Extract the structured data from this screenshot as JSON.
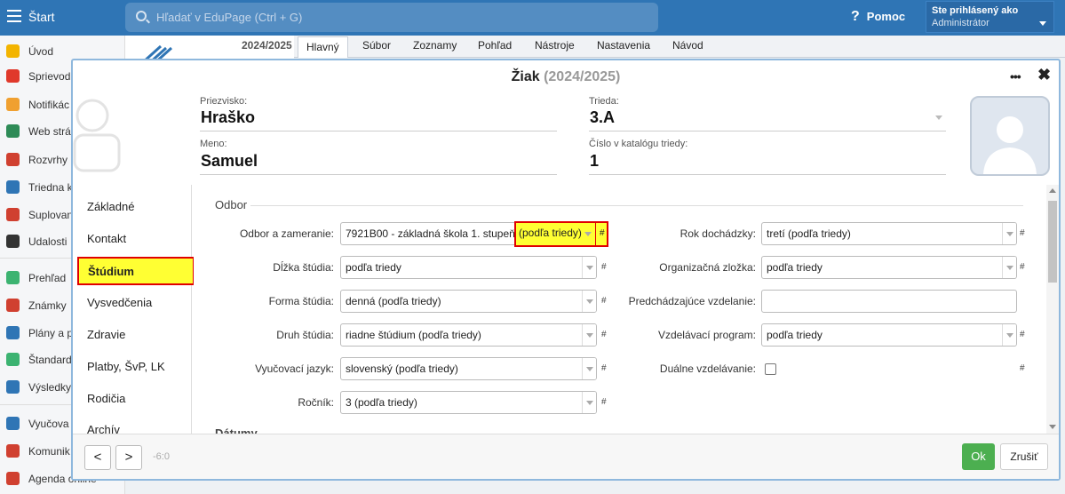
{
  "topbar": {
    "start_label": "Štart",
    "search_placeholder": "Hľadať v EduPage (Ctrl + G)",
    "help_label": "Pomoc",
    "logged_in_label": "Ste prihlásený ako",
    "user_role": "Administrátor"
  },
  "sidebar": {
    "items": [
      {
        "label": "Úvod",
        "icon": "star-icon",
        "color": "#f3b400"
      },
      {
        "label": "Sprievod",
        "icon": "wand-icon",
        "color": "#e0392b"
      },
      {
        "label": "Notifikác",
        "icon": "envelope-icon",
        "color": "#f0a030"
      },
      {
        "label": "Web strá",
        "icon": "home-icon",
        "color": "#2e8b57"
      },
      {
        "label": "Rozvrhy",
        "icon": "grid-icon",
        "color": "#d04030"
      },
      {
        "label": "Triedna k",
        "icon": "book-icon",
        "color": "#2f75b5"
      },
      {
        "label": "Suplovan",
        "icon": "person-icon",
        "color": "#d04030"
      },
      {
        "label": "Udalosti",
        "icon": "calendar-icon",
        "color": "#333333"
      },
      {
        "label": "Prehľad",
        "icon": "check-circle-icon",
        "color": "#3cb371"
      },
      {
        "label": "Známky",
        "icon": "grade-icon",
        "color": "#d04030"
      },
      {
        "label": "Plány a p",
        "icon": "briefcase-icon",
        "color": "#2f75b5"
      },
      {
        "label": "Štandard",
        "icon": "shield-icon",
        "color": "#3cb371"
      },
      {
        "label": "Výsledky",
        "icon": "bar-chart-icon",
        "color": "#2f75b5"
      },
      {
        "label": "Vyučova",
        "icon": "books-icon",
        "color": "#2f75b5"
      },
      {
        "label": "Komunik",
        "icon": "chat-icon",
        "color": "#d04030"
      },
      {
        "label": "Agenda online",
        "icon": "agenda-icon",
        "color": "#d04030"
      }
    ]
  },
  "school": {
    "year": "2024/2025"
  },
  "tabs": [
    "Hlavný",
    "Súbor",
    "Zoznamy",
    "Pohľad",
    "Nástroje",
    "Nastavenia",
    "Návod"
  ],
  "modal": {
    "title": "Žiak",
    "year": "(2024/2025)",
    "more_label": "•••",
    "close_label": "✖",
    "surname_label": "Priezvisko:",
    "surname": "Hraško",
    "name_label": "Meno:",
    "name": "Samuel",
    "class_label": "Trieda:",
    "class_value": "3.A",
    "catalog_label": "Číslo v katalógu triedy:",
    "catalog_value": "1",
    "nav": [
      "Základné",
      "Kontakt",
      "Štúdium",
      "Vysvedčenia",
      "Zdravie",
      "Platby, ŠvP, LK",
      "Rodičia",
      "Archív"
    ],
    "section": "Odbor",
    "section2": "Dátumy",
    "left_fields": [
      {
        "label": "Odbor a zameranie:",
        "value": "7921B00 - základná škola 1. stupeň"
      },
      {
        "label": "Dĺžka štúdia:",
        "value": "podľa triedy"
      },
      {
        "label": "Forma štúdia:",
        "value": "denná (podľa triedy)"
      },
      {
        "label": "Druh štúdia:",
        "value": "riadne štúdium (podľa triedy)"
      },
      {
        "label": "Vyučovací jazyk:",
        "value": "slovenský (podľa triedy)"
      },
      {
        "label": "Ročník:",
        "value": "3 (podľa triedy)"
      }
    ],
    "highlight_text": "(podľa triedy)",
    "right_fields": [
      {
        "label": "Rok dochádzky:",
        "value": "tretí (podľa triedy)"
      },
      {
        "label": "Organizačná zložka:",
        "value": "podľa triedy"
      },
      {
        "label": "Predchádzajúce vzdelanie:",
        "value": ""
      },
      {
        "label": "Vzdelávací program:",
        "value": "podľa triedy"
      },
      {
        "label": "Duálne vzdelávanie:",
        "value": ""
      }
    ],
    "hash": "#",
    "prev_label": "<",
    "next_label": ">",
    "page_info": "-6:0",
    "ok_label": "Ok",
    "cancel_label": "Zrušiť"
  }
}
